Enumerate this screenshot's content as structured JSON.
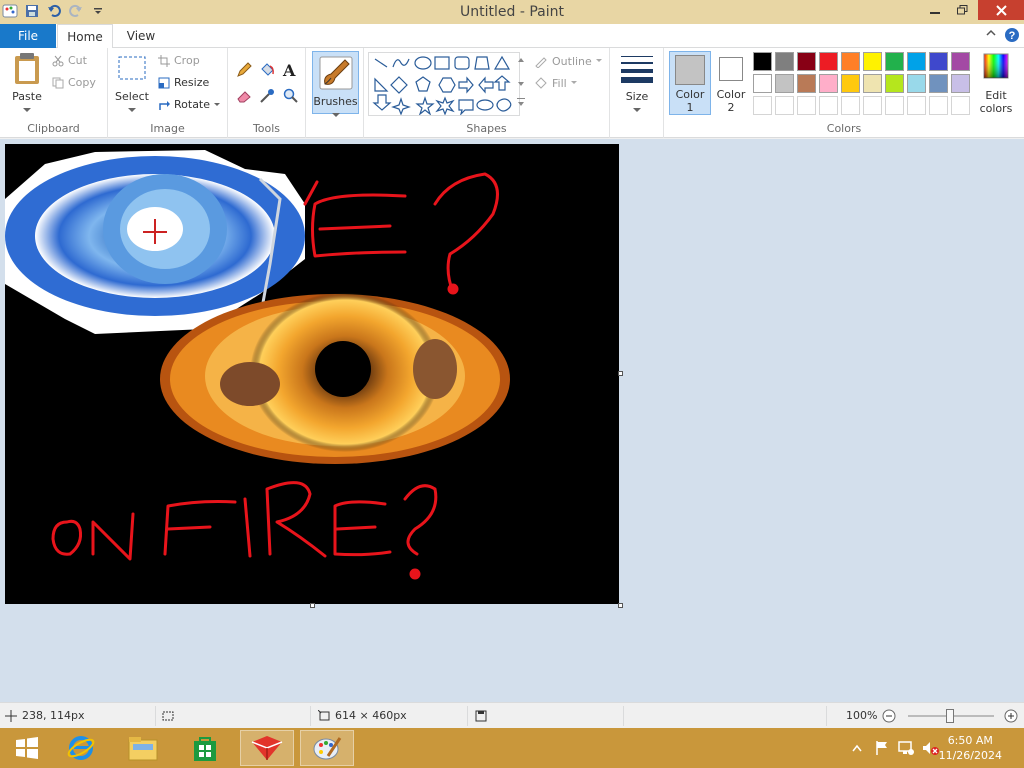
{
  "window": {
    "title": "Untitled - Paint"
  },
  "tabs": {
    "file": "File",
    "home": "Home",
    "view": "View"
  },
  "clipboard": {
    "paste": "Paste",
    "cut": "Cut",
    "copy": "Copy",
    "label": "Clipboard"
  },
  "image": {
    "select": "Select",
    "crop": "Crop",
    "resize": "Resize",
    "rotate": "Rotate",
    "label": "Image"
  },
  "tools": {
    "label": "Tools"
  },
  "brushes": {
    "label": "Brushes"
  },
  "shapes": {
    "outline": "Outline",
    "fill": "Fill",
    "label": "Shapes"
  },
  "size": {
    "label": "Size"
  },
  "colors": {
    "color1": "Color",
    "color1_num": "1",
    "color2": "Color",
    "color2_num": "2",
    "edit": "Edit",
    "edit2": "colors",
    "label": "Colors",
    "color1_value": "#c3c3c3",
    "color2_value": "#ffffff",
    "palette_row1": [
      "#000000",
      "#7f7f7f",
      "#880015",
      "#ed1c24",
      "#ff7f27",
      "#fff200",
      "#22b14c",
      "#00a2e8",
      "#3f48cc",
      "#a349a4"
    ],
    "palette_row2": [
      "#ffffff",
      "#c3c3c3",
      "#b97a57",
      "#ffaec9",
      "#ffc90e",
      "#efe4b0",
      "#b5e61d",
      "#99d9ea",
      "#7092be",
      "#c8bfe7"
    ]
  },
  "canvas_text": {
    "line1": "E?",
    "line2": "ON FIRE?"
  },
  "status": {
    "cursor": "238, 114px",
    "dims": "614 × 460px",
    "zoom": "100%"
  },
  "clock": {
    "time": "6:50 AM",
    "date": "11/26/2024"
  }
}
